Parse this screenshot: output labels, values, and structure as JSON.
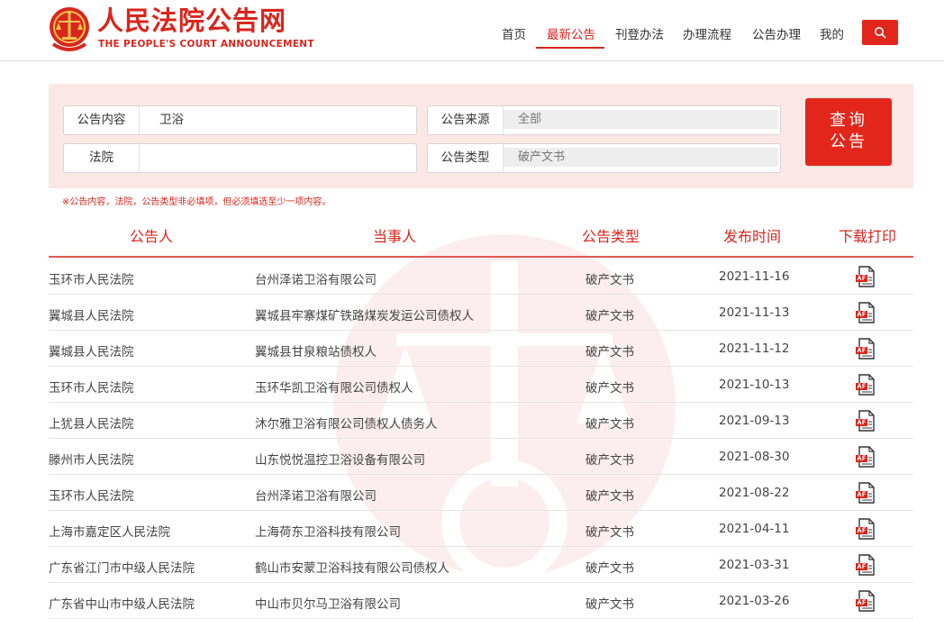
{
  "header": {
    "site_title": "人民法院公告网",
    "site_subtitle": "THE PEOPLE'S COURT ANNOUNCEMENT",
    "brand_color": "#d9261c",
    "nav": [
      {
        "label": "首页"
      },
      {
        "label": "最新公告",
        "active": true
      },
      {
        "label": "刊登办法"
      },
      {
        "label": "办理流程"
      },
      {
        "label": "公告办理"
      },
      {
        "label": "我的"
      }
    ],
    "search_icon": "search-icon"
  },
  "search": {
    "content_label": "公告内容",
    "content_value": "卫浴",
    "court_label": "法院",
    "court_value": "",
    "source_label": "公告来源",
    "source_value": "全部",
    "type_label": "公告类型",
    "type_value": "破产文书",
    "query_line1": "查询",
    "query_line2": "公告",
    "notice": "※公告内容，法院，公告类型非必填项，但必须填选至少一项内容。"
  },
  "table": {
    "headers": {
      "announcer": "公告人",
      "party": "当事人",
      "type": "公告类型",
      "date": "发布时间",
      "download": "下载打印"
    },
    "download_icon": "pdf-icon",
    "rows": [
      {
        "announcer": "玉环市人民法院",
        "party": "台州泽诺卫浴有限公司",
        "type": "破产文书",
        "date": "2021-11-16"
      },
      {
        "announcer": "翼城县人民法院",
        "party": "翼城县牢寨煤矿铁路煤炭发运公司债权人",
        "type": "破产文书",
        "date": "2021-11-13"
      },
      {
        "announcer": "翼城县人民法院",
        "party": "翼城县甘泉粮站债权人",
        "type": "破产文书",
        "date": "2021-11-12"
      },
      {
        "announcer": "玉环市人民法院",
        "party": "玉环华凯卫浴有限公司债权人",
        "type": "破产文书",
        "date": "2021-10-13"
      },
      {
        "announcer": "上犹县人民法院",
        "party": "沐尔雅卫浴有限公司债权人债务人",
        "type": "破产文书",
        "date": "2021-09-13"
      },
      {
        "announcer": "滕州市人民法院",
        "party": "山东悦悦温控卫浴设备有限公司",
        "type": "破产文书",
        "date": "2021-08-30"
      },
      {
        "announcer": "玉环市人民法院",
        "party": "台州泽诺卫浴有限公司",
        "type": "破产文书",
        "date": "2021-08-22"
      },
      {
        "announcer": "上海市嘉定区人民法院",
        "party": "上海荷东卫浴科技有限公司",
        "type": "破产文书",
        "date": "2021-04-11"
      },
      {
        "announcer": "广东省江门市中级人民法院",
        "party": "鹤山市安蒙卫浴科技有限公司债权人",
        "type": "破产文书",
        "date": "2021-03-31"
      },
      {
        "announcer": "广东省中山市中级人民法院",
        "party": "中山市贝尔马卫浴有限公司",
        "type": "破产文书",
        "date": "2021-03-26"
      }
    ]
  }
}
